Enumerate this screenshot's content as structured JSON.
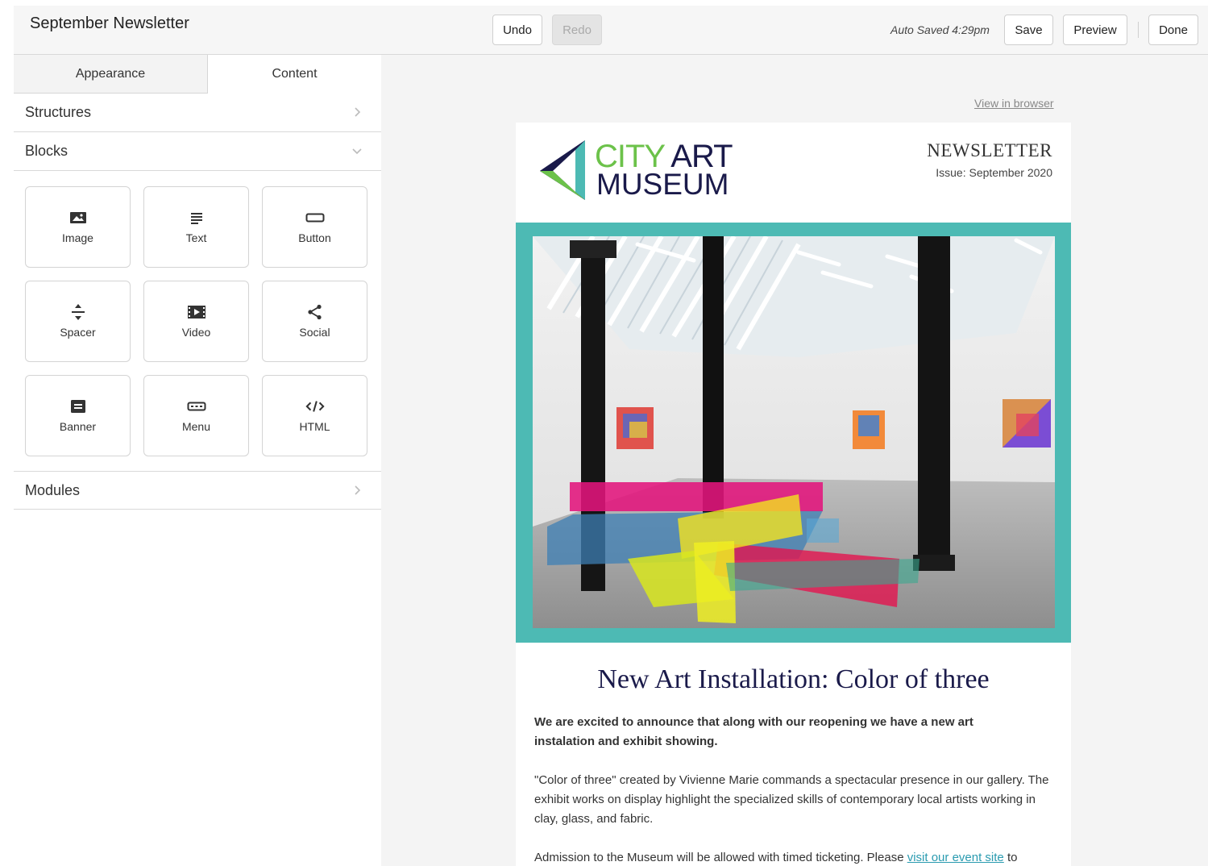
{
  "header": {
    "doc_title": "September Newsletter",
    "undo_label": "Undo",
    "redo_label": "Redo",
    "autosave_text": "Auto Saved 4:29pm",
    "save_label": "Save",
    "preview_label": "Preview",
    "done_label": "Done"
  },
  "sidebar": {
    "tabs": [
      {
        "label": "Appearance",
        "active": false
      },
      {
        "label": "Content",
        "active": true
      }
    ],
    "sections": {
      "structures": "Structures",
      "blocks": "Blocks",
      "modules": "Modules"
    },
    "blocks": [
      {
        "label": "Image",
        "icon": "image-icon"
      },
      {
        "label": "Text",
        "icon": "text-icon"
      },
      {
        "label": "Button",
        "icon": "button-icon"
      },
      {
        "label": "Spacer",
        "icon": "spacer-icon"
      },
      {
        "label": "Video",
        "icon": "video-icon"
      },
      {
        "label": "Social",
        "icon": "share-icon"
      },
      {
        "label": "Banner",
        "icon": "banner-icon"
      },
      {
        "label": "Menu",
        "icon": "menu-icon"
      },
      {
        "label": "HTML",
        "icon": "code-icon"
      }
    ]
  },
  "email": {
    "view_in_browser": "View in browser",
    "logo_line1_a": "CITY",
    "logo_line1_b": "ART",
    "logo_line2": "MUSEUM",
    "newsletter_label": "NEWSLETTER",
    "issue": "Issue: September 2020",
    "headline": "New Art Installation: Color of three",
    "intro": "We are excited to announce that along with our reopening we have a new art instalation and exhibit showing.",
    "para1": "\"Color of three\" created by Vivienne Marie commands a spectacular presence in our gallery. The exhibit works on display highlight the specialized skills of contemporary local artists working in clay, glass, and fabric.",
    "para2_before": "Admission to the Museum will be allowed with timed ticketing. Please ",
    "para2_link": "visit our event site",
    "para2_after": " to"
  },
  "colors": {
    "hero_border": "#4dbab4",
    "logo_green": "#6cc24a",
    "logo_navy": "#1a1a4a",
    "link": "#2a9bb0"
  }
}
